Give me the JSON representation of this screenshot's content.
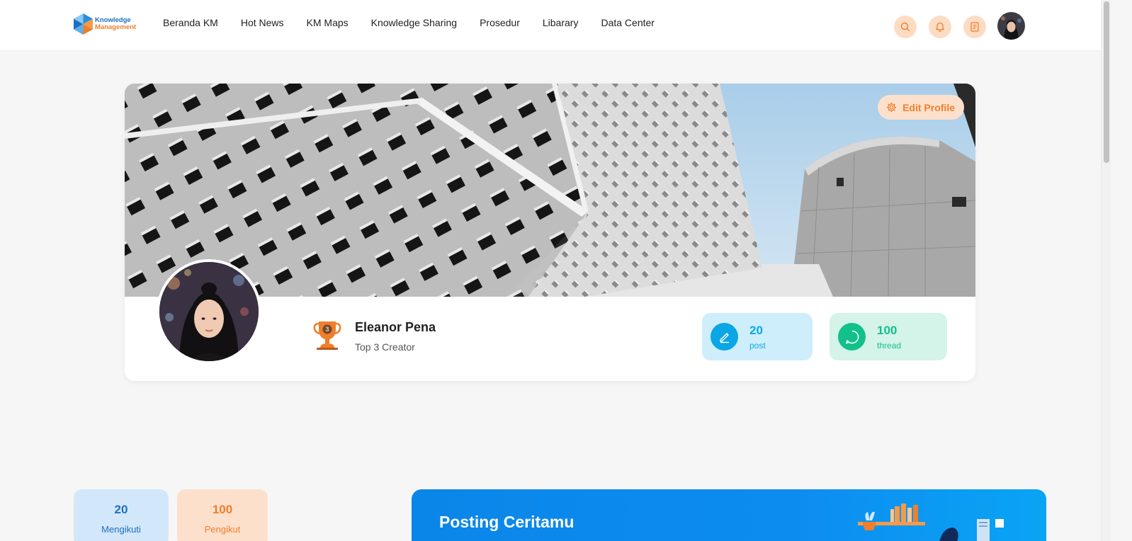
{
  "brand": {
    "line1": "Knowledge",
    "line2": "Management"
  },
  "nav": {
    "links": [
      "Beranda KM",
      "Hot News",
      "KM Maps",
      "Knowledge Sharing",
      "Prosedur",
      "Libarary",
      "Data Center"
    ],
    "icons": [
      "search-icon",
      "bell-icon",
      "document-icon"
    ]
  },
  "profile": {
    "edit_label": "Edit Profile",
    "name": "Eleanor Pena",
    "rank": "Top 3 Creator",
    "trophy_number": "3",
    "stats": {
      "post": {
        "value": "20",
        "label": "post"
      },
      "thread": {
        "value": "100",
        "label": "thread"
      }
    }
  },
  "follow": {
    "following": {
      "value": "20",
      "label": "Mengikuti"
    },
    "followers": {
      "value": "100",
      "label": "Pengikut"
    }
  },
  "post_banner": {
    "title": "Posting Ceritamu"
  },
  "colors": {
    "accent_orange": "#f07e2a",
    "accent_blue": "#0a86e8",
    "post_blue": "#0aa6e6",
    "thread_green": "#11c08b"
  }
}
